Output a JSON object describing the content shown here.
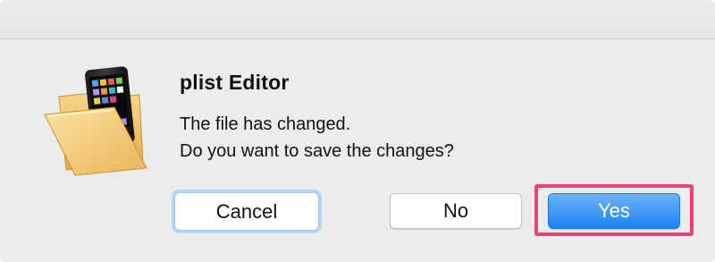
{
  "dialog": {
    "title": "plist Editor",
    "message_line1": "The file has changed.",
    "message_line2": "Do you want to save the changes?"
  },
  "buttons": {
    "cancel_label": "Cancel",
    "no_label": "No",
    "yes_label": "Yes"
  },
  "icons": {
    "app_icon": "folder-with-ipod-icon"
  },
  "colors": {
    "default_button": "#1b82f5",
    "highlight_outline": "#ee3f7c",
    "window_background": "#ececec"
  }
}
